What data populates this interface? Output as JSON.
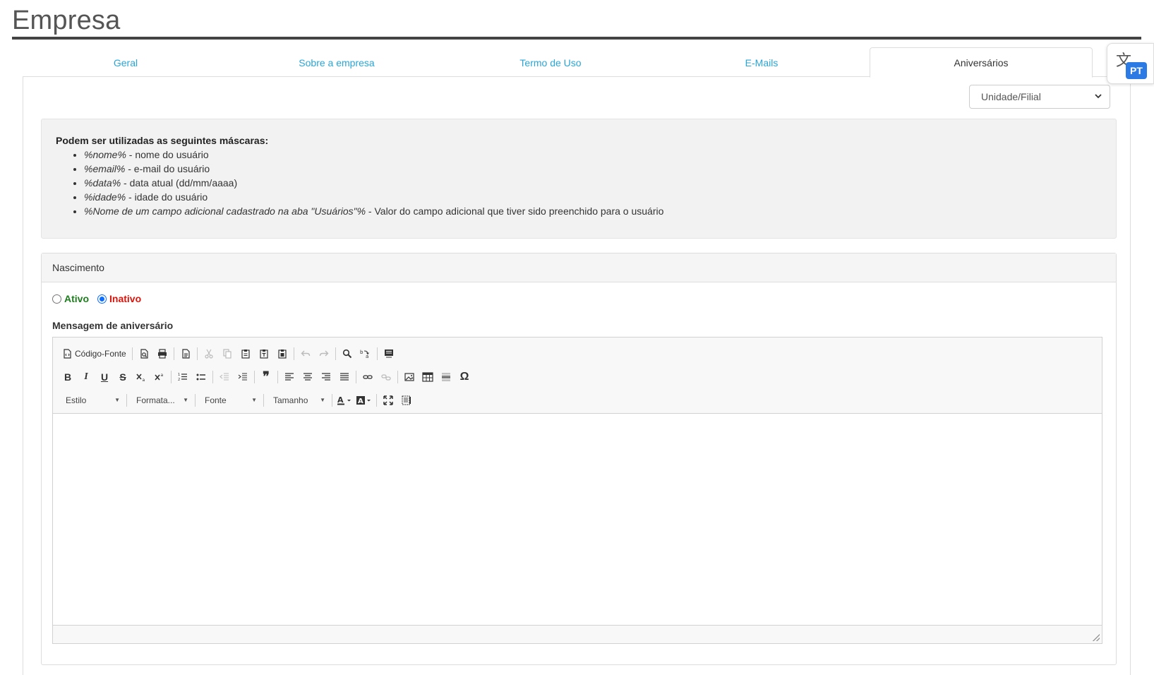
{
  "page": {
    "title": "Empresa"
  },
  "tabs": [
    {
      "label": "Geral"
    },
    {
      "label": "Sobre a empresa"
    },
    {
      "label": "Termo de Uso"
    },
    {
      "label": "E-Mails"
    },
    {
      "label": "Aniversários"
    }
  ],
  "active_tab": "Aniversários",
  "unit_select": {
    "value": "Unidade/Filial"
  },
  "masks_info": {
    "heading": "Podem ser utilizadas as seguintes máscaras:",
    "items": [
      {
        "mask": "%nome%",
        "desc": " - nome do usuário"
      },
      {
        "mask": "%email%",
        "desc": " - e-mail do usuário"
      },
      {
        "mask": "%data%",
        "desc": " - data atual (dd/mm/aaaa)"
      },
      {
        "mask": "%idade%",
        "desc": " - idade do usuário"
      },
      {
        "mask": "%Nome de um campo adicional cadastrado na aba \"Usuários\"%",
        "desc": " - Valor do campo adicional que tiver sido preenchido para o usuário"
      }
    ]
  },
  "birth_card": {
    "title": "Nascimento",
    "radio_active": "Ativo",
    "radio_inactive": "Inativo",
    "selected": "Inativo",
    "message_label": "Mensagem de aniversário"
  },
  "editor": {
    "source_label": "Código-Fonte",
    "combos": {
      "style": "Estilo",
      "format": "Formata...",
      "font": "Fonte",
      "size": "Tamanho"
    }
  },
  "translate_widget": {
    "glyph": "文",
    "badge": "PT"
  },
  "colors": {
    "tab_link": "#2aa5d6",
    "active_green": "#1e7d1e",
    "inactive_red": "#d9140b",
    "radio_blue": "#0d6efd",
    "badge_blue": "#2c7be5"
  }
}
